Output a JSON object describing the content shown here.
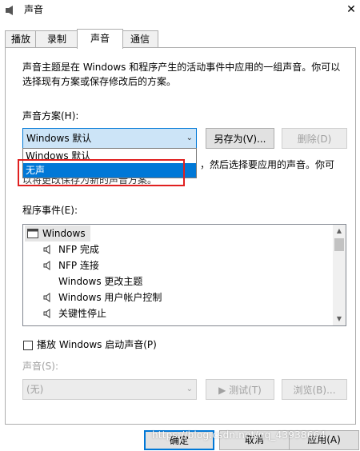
{
  "window": {
    "title": "声音",
    "close_label": "✕"
  },
  "tabs": [
    {
      "label": "播放"
    },
    {
      "label": "录制"
    },
    {
      "label": "声音"
    },
    {
      "label": "通信"
    }
  ],
  "description": {
    "line1": "声音主题是在 Windows 和程序产生的活动事件中应用的一组声音。你可以",
    "line2": "选择现有方案或保存修改后的方案。"
  },
  "scheme": {
    "label": "声音方案(H):",
    "selected": "Windows 默认",
    "save_as_button": "另存为(V)...",
    "delete_button": "删除(D)",
    "options": [
      "Windows 默认",
      "无声"
    ],
    "highlighted_option": "无声"
  },
  "hint": {
    "line1_visible": "，然后选择要应用的声音。你可",
    "line2_visible": "以将更改保存为新的声音方案。"
  },
  "events": {
    "label": "程序事件(E):",
    "items": [
      {
        "text": "Windows",
        "type": "group"
      },
      {
        "text": "NFP 完成",
        "type": "sound"
      },
      {
        "text": "NFP 连接",
        "type": "sound"
      },
      {
        "text": "Windows 更改主题",
        "type": "none"
      },
      {
        "text": "Windows 用户帐户控制",
        "type": "sound"
      },
      {
        "text": "关键性停止",
        "type": "sound"
      }
    ]
  },
  "startup_sound": {
    "label": "播放 Windows 启动声音(P)",
    "checked": false
  },
  "sound": {
    "label": "声音(S):",
    "selected": "(无)",
    "test_button": "测试(T)",
    "browse_button": "浏览(B)..."
  },
  "footer": {
    "ok_button": "确定",
    "cancel_button": "取消",
    "apply_button": "应用(A)"
  },
  "watermark": "https://blog.csdn.net/qq_43938664",
  "colors": {
    "accent": "#0078d7",
    "highlight_box": "#e02020",
    "disabled_text": "#a0a0a0"
  }
}
